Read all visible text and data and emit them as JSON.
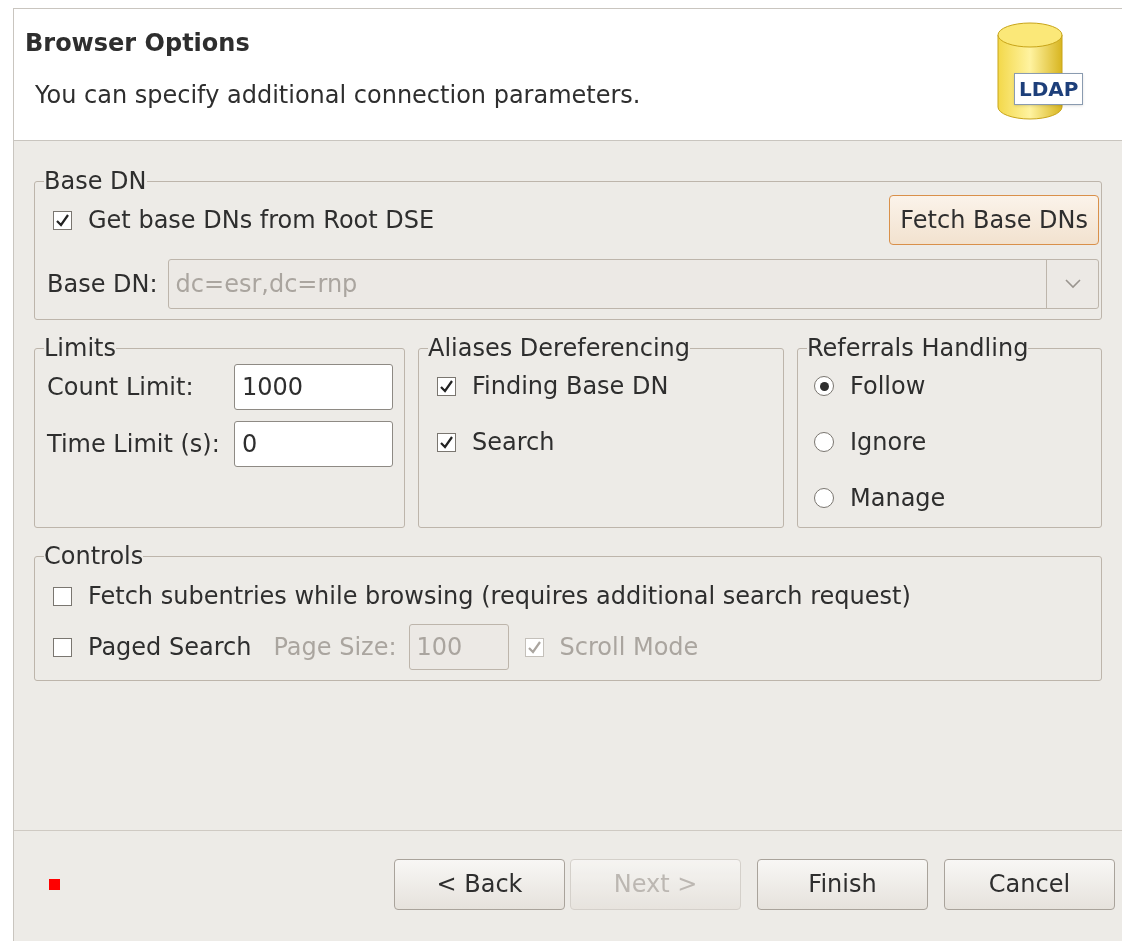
{
  "header": {
    "title": "Browser Options",
    "description": "You can specify additional connection parameters.",
    "logo_text": "LDAP"
  },
  "base_dn_group": {
    "label": "Base DN",
    "get_from_root": {
      "label": "Get base DNs from Root DSE",
      "checked": true
    },
    "fetch_button": "Fetch Base DNs",
    "field_label": "Base DN:",
    "field_value": "dc=esr,dc=rnp",
    "field_disabled": true
  },
  "limits_group": {
    "label": "Limits",
    "fields": [
      {
        "label": "Count Limit:",
        "value": "1000"
      },
      {
        "label": "Time Limit (s):",
        "value": "0"
      }
    ]
  },
  "aliases_group": {
    "label": "Aliases Dereferencing",
    "options": [
      {
        "label": "Finding Base DN",
        "checked": true
      },
      {
        "label": "Search",
        "checked": true
      }
    ]
  },
  "referrals_group": {
    "label": "Referrals Handling",
    "options": [
      {
        "label": "Follow",
        "selected": true
      },
      {
        "label": "Ignore",
        "selected": false
      },
      {
        "label": "Manage",
        "selected": false
      }
    ]
  },
  "controls_group": {
    "label": "Controls",
    "subentries": {
      "label": "Fetch subentries while browsing (requires additional search request)",
      "checked": false
    },
    "paged_search": {
      "label": "Paged Search",
      "checked": false
    },
    "page_size_label": "Page Size:",
    "page_size_value": "100",
    "scroll_mode": {
      "label": "Scroll Mode",
      "checked": true
    },
    "paged_options_disabled": true
  },
  "buttons": [
    {
      "label": "< Back",
      "disabled": false
    },
    {
      "label": "Next >",
      "disabled": true
    },
    {
      "label": "Finish",
      "disabled": false
    },
    {
      "label": "Cancel",
      "disabled": false
    }
  ]
}
